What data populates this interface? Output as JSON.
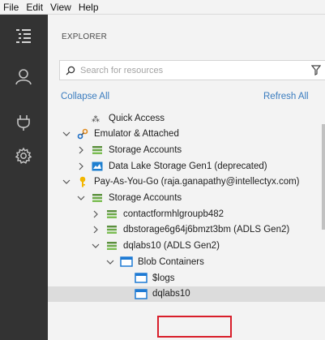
{
  "menu": [
    "File",
    "Edit",
    "View",
    "Help"
  ],
  "activity_bar": {
    "icons": [
      "explorer-icon",
      "account-icon",
      "plug-icon",
      "settings-icon"
    ]
  },
  "explorer": {
    "title": "EXPLORER",
    "search_placeholder": "Search for resources",
    "collapse_all": "Collapse All",
    "refresh_all": "Refresh All"
  },
  "tree": [
    {
      "label": "Quick Access",
      "indent": 1,
      "expanded": null,
      "icon": "quick-access-icon"
    },
    {
      "label": "Emulator & Attached",
      "indent": 0,
      "expanded": true,
      "icon": "link-icon"
    },
    {
      "label": "Storage Accounts",
      "indent": 1,
      "expanded": false,
      "icon": "storage-icon"
    },
    {
      "label": "Data Lake Storage Gen1 (deprecated)",
      "indent": 1,
      "expanded": false,
      "icon": "datalake-icon"
    },
    {
      "label": "Pay-As-You-Go (raja.ganapathy@intellectyx.com)",
      "indent": 0,
      "expanded": true,
      "icon": "key-icon"
    },
    {
      "label": "Storage Accounts",
      "indent": 1,
      "expanded": true,
      "icon": "storage-icon"
    },
    {
      "label": "contactformhlgroupb482",
      "indent": 2,
      "expanded": false,
      "icon": "storage-icon"
    },
    {
      "label": "dbstorage6g64j6bmzt3bm (ADLS Gen2)",
      "indent": 2,
      "expanded": false,
      "icon": "storage-icon"
    },
    {
      "label": "dqlabs10 (ADLS Gen2)",
      "indent": 2,
      "expanded": true,
      "icon": "storage-icon"
    },
    {
      "label": "Blob Containers",
      "indent": 3,
      "expanded": true,
      "icon": "container-icon"
    },
    {
      "label": "$logs",
      "indent": 4,
      "expanded": null,
      "icon": "container-icon"
    },
    {
      "label": "dqlabs10",
      "indent": 4,
      "expanded": null,
      "icon": "container-icon",
      "selected": true
    }
  ],
  "colors": {
    "activity_bar": "#333333",
    "link": "#3a7cbf",
    "highlight": "#d81e2a",
    "selected_row": "#dcdcdc"
  }
}
